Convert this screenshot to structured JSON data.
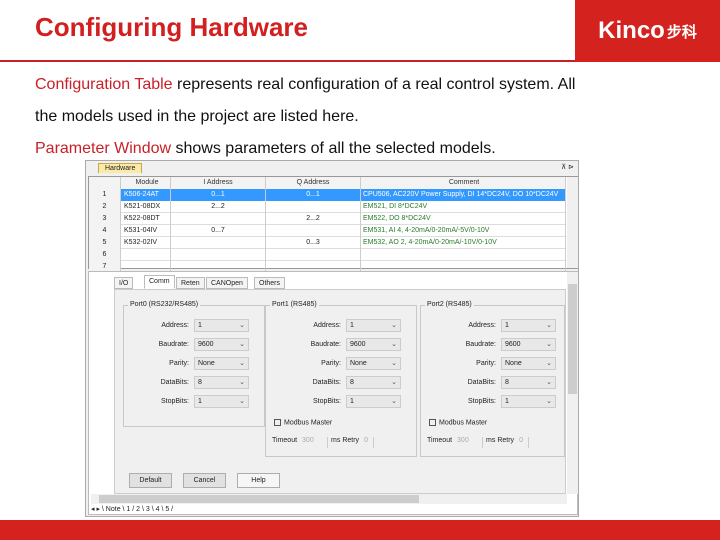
{
  "title": "Configuring Hardware",
  "logo": {
    "text": "Kinco",
    "cn": "步科"
  },
  "para1": {
    "bold": "Configuration Table",
    "text": " represents real configuration of a real control system. All"
  },
  "para2": "the models used in the project are listed here.",
  "para3": {
    "bold": "Parameter Window",
    "text": " shows parameters of all the selected models."
  },
  "window": {
    "hardware_tab": "Hardware",
    "pin": "⊼ ⊳",
    "columns": [
      "",
      "Module",
      "I Address",
      "Q Address",
      "Comment"
    ],
    "rows": [
      [
        "1",
        "K506-24AT",
        "0...1",
        "0...1",
        "CPU506, AC220V Power Supply, DI 14*DC24V, DO 10*DC24V"
      ],
      [
        "2",
        "K521-08DX",
        "2...2",
        "",
        "EM521, DI 8*DC24V"
      ],
      [
        "3",
        "K522-08DT",
        "",
        "2...2",
        "EM522, DO 8*DC24V"
      ],
      [
        "4",
        "K531-04IV",
        "0...7",
        "",
        "EM531, AI 4, 4-20mA/0-20mA/-5V/0-10V"
      ],
      [
        "5",
        "K532-02IV",
        "",
        "0...3",
        "EM532, AO 2, 4-20mA/0-20mA/-10V/0-10V"
      ],
      [
        "6",
        "",
        "",
        "",
        ""
      ],
      [
        "7",
        "",
        "",
        "",
        ""
      ]
    ],
    "param_tabs": [
      "I/O",
      "Comm",
      "Reten",
      "CANOpen",
      "Others"
    ],
    "active_param_tab": "Comm",
    "ports": [
      {
        "label": "Port0 (RS232/RS485)",
        "fields": [
          [
            "Address:",
            "1"
          ],
          [
            "Baudrate:",
            "9600"
          ],
          [
            "Parity:",
            "None"
          ],
          [
            "DataBits:",
            "8"
          ],
          [
            "StopBits:",
            "1"
          ]
        ]
      },
      {
        "label": "Port1 (RS485)",
        "fields": [
          [
            "Address:",
            "1"
          ],
          [
            "Baudrate:",
            "9600"
          ],
          [
            "Parity:",
            "None"
          ],
          [
            "DataBits:",
            "8"
          ],
          [
            "StopBits:",
            "1"
          ]
        ],
        "modbus_master": "Modbus Master",
        "timeout_label": "Timeout",
        "timeout": "300",
        "ms": "ms",
        "retry_label": "Retry",
        "retry": "0"
      },
      {
        "label": "Port2 (RS485)",
        "fields": [
          [
            "Address:",
            "1"
          ],
          [
            "Baudrate:",
            "9600"
          ],
          [
            "Parity:",
            "None"
          ],
          [
            "DataBits:",
            "8"
          ],
          [
            "StopBits:",
            "1"
          ]
        ],
        "modbus_master": "Modbus Master",
        "timeout_label": "Timeout",
        "timeout": "300",
        "ms": "ms",
        "retry_label": "Retry",
        "retry": "0"
      }
    ],
    "buttons": {
      "default": "Default",
      "cancel": "Cancel",
      "help": "Help"
    },
    "sheets": "◂ ▸ \\ Note \\ 1 / 2 \\ 3 \\ 4 \\ 5 /"
  }
}
